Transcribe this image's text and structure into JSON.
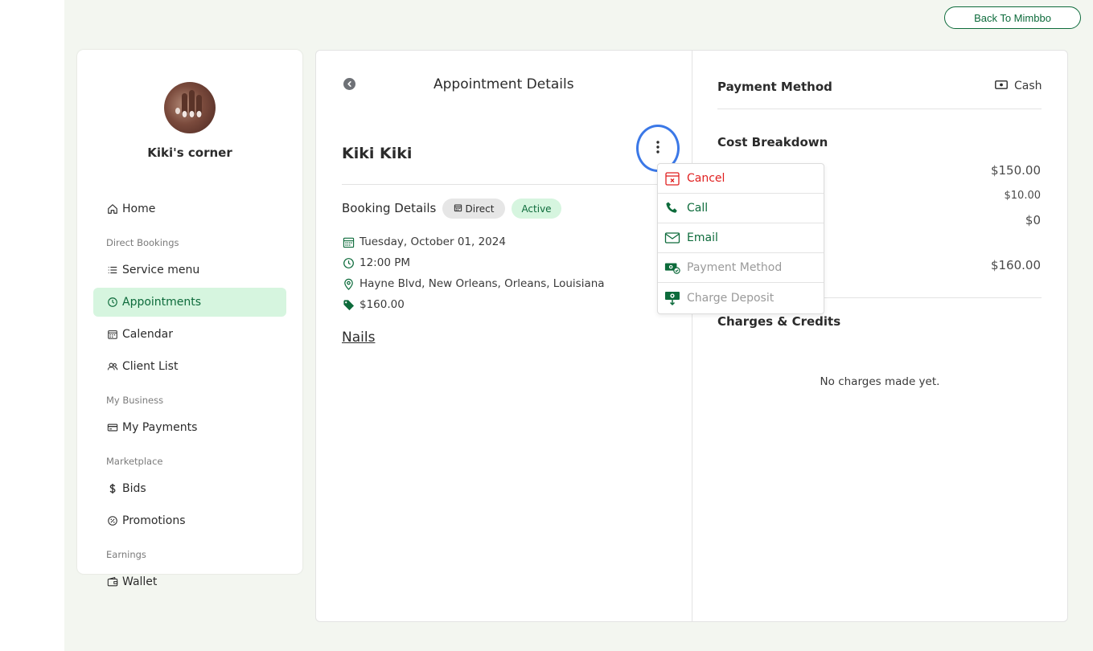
{
  "header": {
    "back_button": "Back To Mimbbo"
  },
  "sidebar": {
    "business_name": "Kiki's corner",
    "items": [
      {
        "label": "Home",
        "icon": "home-icon"
      },
      {
        "section": "Direct Bookings"
      },
      {
        "label": "Service menu",
        "icon": "list-icon"
      },
      {
        "label": "Appointments",
        "icon": "clock-icon",
        "active": true
      },
      {
        "label": "Calendar",
        "icon": "calendar-icon"
      },
      {
        "label": "Client List",
        "icon": "users-icon"
      },
      {
        "section": "My Business"
      },
      {
        "label": "My Payments",
        "icon": "card-icon"
      },
      {
        "section": "Marketplace"
      },
      {
        "label": "Bids",
        "icon": "dollar-icon"
      },
      {
        "label": "Promotions",
        "icon": "percent-badge-icon"
      },
      {
        "section": "Earnings"
      },
      {
        "label": "Wallet",
        "icon": "wallet-icon"
      }
    ]
  },
  "appointment": {
    "title": "Appointment Details",
    "client_name": "Kiki Kiki",
    "booking_details_label": "Booking Details",
    "badges": {
      "type": "Direct",
      "status": "Active"
    },
    "date": "Tuesday, October 01, 2024",
    "time": "12:00 PM",
    "location": "Hayne Blvd, New Orleans, Orleans, Louisiana",
    "price": "$160.00",
    "service": "Nails"
  },
  "payment": {
    "method_label": "Payment Method",
    "method_value": "Cash",
    "cost_label": "Cost Breakdown",
    "amounts": [
      "$150.00",
      "$10.00",
      "$0",
      "$160.00"
    ],
    "charges_label": "Charges & Credits",
    "no_charges": "No charges made yet."
  },
  "menu": {
    "items": [
      {
        "label": "Cancel",
        "icon": "calendar-x-icon"
      },
      {
        "label": "Call",
        "icon": "phone-icon"
      },
      {
        "label": "Email",
        "icon": "mail-icon"
      },
      {
        "label": "Payment Method",
        "icon": "cash-check-icon"
      },
      {
        "label": "Charge Deposit",
        "icon": "cash-down-icon"
      }
    ]
  },
  "colors": {
    "accent": "#0d6b3b",
    "active_bg": "#d6f5df",
    "danger": "#e02020",
    "highlight_ring": "#3b78e7",
    "page_bg": "#f3f6f0"
  }
}
